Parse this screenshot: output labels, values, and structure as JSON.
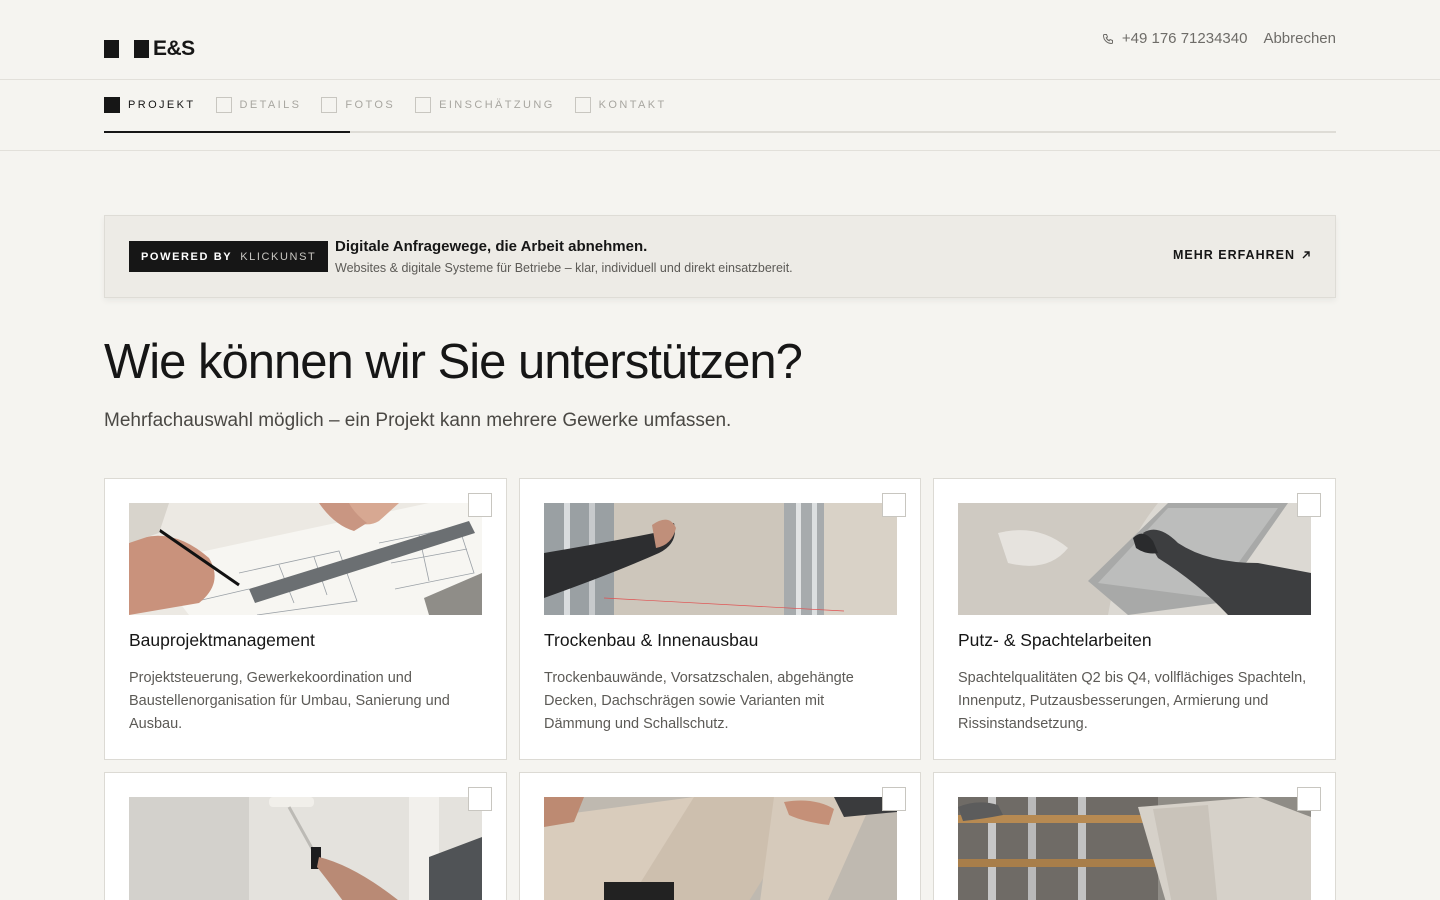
{
  "header": {
    "logo_text": "E&S",
    "phone": "+49 176 71234340",
    "cancel_label": "Abbrechen"
  },
  "steps": [
    {
      "label": "PROJEKT",
      "active": true
    },
    {
      "label": "DETAILS",
      "active": false
    },
    {
      "label": "FOTOS",
      "active": false
    },
    {
      "label": "EINSCHÄTZUNG",
      "active": false
    },
    {
      "label": "KONTAKT",
      "active": false
    }
  ],
  "progress_fraction": 0.2,
  "banner": {
    "powered_by": "POWERED BY",
    "brand": "KLICKUNST",
    "title": "Digitale Anfragewege, die Arbeit abnehmen.",
    "subtitle": "Websites & digitale Systeme für Betriebe – klar, individuell und direkt einsatzbereit.",
    "link_label": "MEHR ERFAHREN"
  },
  "main": {
    "title": "Wie können wir Sie unterstützen?",
    "subtitle": "Mehrfachauswahl möglich – ein Projekt kann mehrere Gewerke umfassen."
  },
  "services": [
    {
      "title": "Bauprojektmanagement",
      "description": "Projektsteuerung, Gewerkekoordination und Baustellenorganisation für Umbau, Sanierung und Ausbau.",
      "image": "blueprint-planning-photo",
      "selected": false
    },
    {
      "title": "Trockenbau & Innenausbau",
      "description": "Trockenbauwände, Vorsatzschalen, abgehängte Decken, Dachschrägen sowie Varianten mit Dämmung und Schallschutz.",
      "image": "drywall-installation-photo",
      "selected": false
    },
    {
      "title": "Putz- & Spachtelarbeiten",
      "description": "Spachtelqualitäten Q2 bis Q4, vollflächiges Spachteln, Innenputz, Putzausbesserungen, Armierung und Rissinstandsetzung.",
      "image": "plastering-trowel-photo",
      "selected": false
    },
    {
      "title": "",
      "description": "",
      "image": "wall-painting-roller-photo",
      "selected": false
    },
    {
      "title": "",
      "description": "",
      "image": "laminate-flooring-photo",
      "selected": false
    },
    {
      "title": "",
      "description": "",
      "image": "tile-panels-wall-photo",
      "selected": false
    }
  ]
}
